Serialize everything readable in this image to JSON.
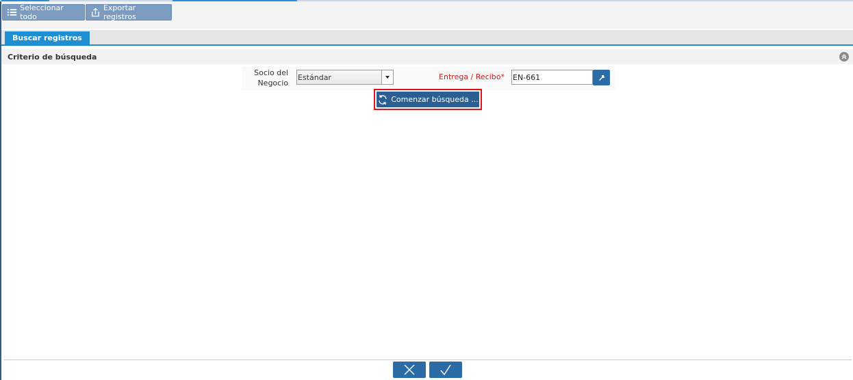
{
  "toolbar": {
    "select_all_label": "Seleccionar todo",
    "export_label": "Exportar registros"
  },
  "tabs": [
    {
      "label": "Buscar registros",
      "active": true
    }
  ],
  "section": {
    "title": "Criterio de búsqueda"
  },
  "criteria": {
    "business_partner_label": "Socio del Negocio",
    "business_partner_value": "Estándar",
    "delivery_label": "Entrega / Recibo",
    "delivery_required_mark": "*",
    "delivery_value": "EN-661"
  },
  "search_button_label": "Comenzar búsqueda ...",
  "colors": {
    "accent": "#1f8fd2",
    "button": "#2b6ba6",
    "toolbar_button": "#7b9cc0",
    "required_label": "#cc1a1a",
    "highlight": "#e0111a"
  },
  "icons": {
    "select_all": "list-icon",
    "export": "export-icon",
    "collapse": "double-chevron-up-icon",
    "dropdown": "caret-down-icon",
    "lookup": "lookup-arrow-icon",
    "search": "refresh-icon",
    "cancel": "close-icon",
    "ok": "check-icon"
  }
}
